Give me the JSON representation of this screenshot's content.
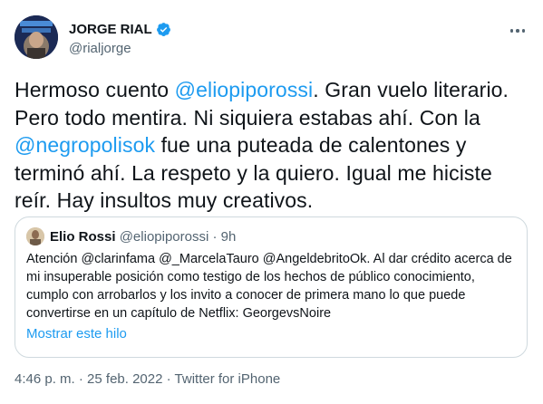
{
  "author": {
    "name": "JORGE RIAL",
    "handle": "@rialjorge"
  },
  "tweet": {
    "segments": [
      {
        "text": "Hermoso cuento ",
        "mention": false
      },
      {
        "text": "@eliopiporossi",
        "mention": true
      },
      {
        "text": ". Gran vuelo literario. Pero todo mentira. Ni siquiera estabas ahí. Con la ",
        "mention": false
      },
      {
        "text": "@negropolisok",
        "mention": true
      },
      {
        "text": " fue una puteada de calentones y terminó ahí. La respeto y la quiero. Igual me hiciste reír. Hay insultos muy creativos.",
        "mention": false
      }
    ]
  },
  "quote": {
    "name": "Elio Rossi",
    "handle": "@eliopiporossi",
    "separator": " · ",
    "time": "9h",
    "text": "Atención @clarinfama @_MarcelaTauro @AngeldebritoOk. Al dar crédito acerca de mi insuperable posición como testigo de los hechos de público conocimiento, cumplo con arrobarlos y los invito a conocer de primera mano lo que puede convertirse en un capítulo de Netflix: GeorgevsNoire",
    "show_thread": "Mostrar este hilo"
  },
  "footer": {
    "time": "4:46 p. m.",
    "sep1": " · ",
    "date": "25 feb. 2022",
    "sep2": " · ",
    "source": "Twitter for iPhone"
  },
  "icons": {
    "verified": "verified-badge-icon",
    "more": "more-horizontal-icon"
  },
  "colors": {
    "accent": "#1d9bf0",
    "text": "#0f1419",
    "muted": "#536471",
    "border": "#cfd9de"
  }
}
